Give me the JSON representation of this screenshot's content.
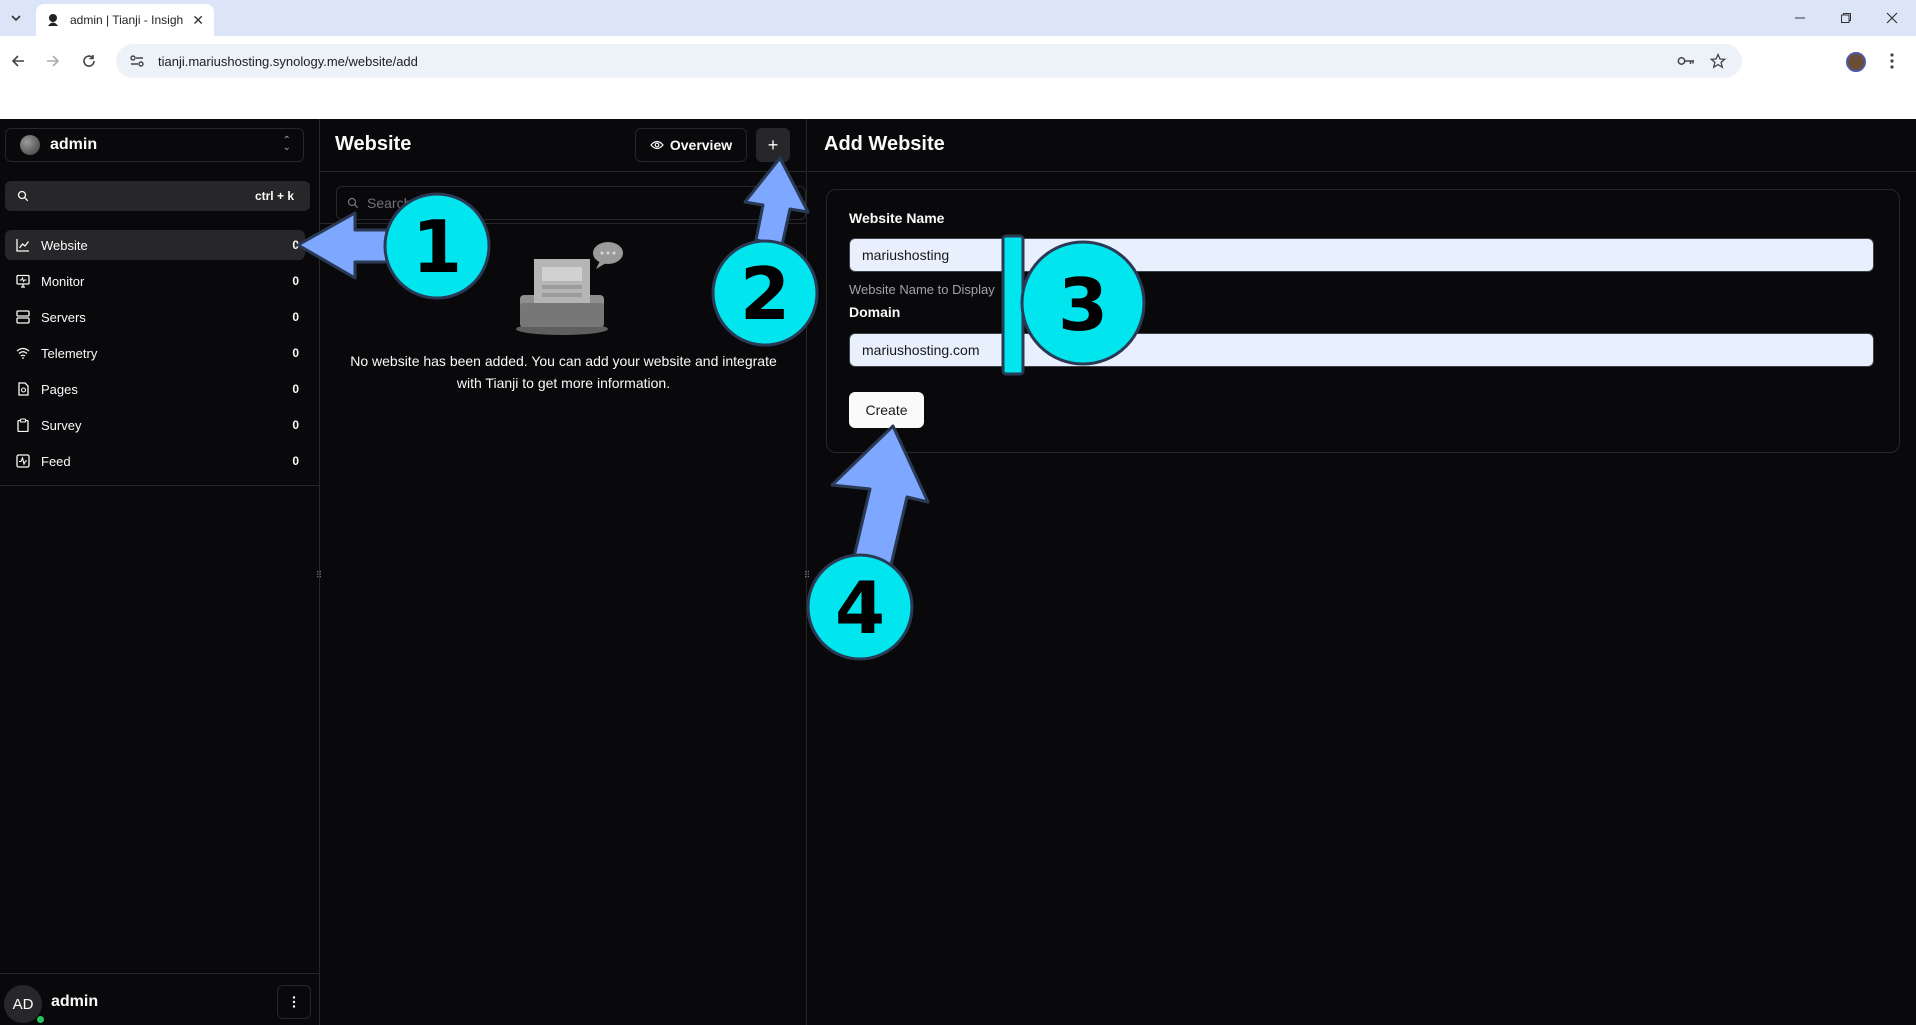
{
  "browser": {
    "tab_title": "admin | Tianji - Insigh",
    "url": "tianji.mariushosting.synology.me/website/add"
  },
  "workspace": {
    "name": "admin"
  },
  "search": {
    "shortcut": "ctrl + k"
  },
  "sidebar": {
    "items": [
      {
        "label": "Website",
        "count": "0",
        "icon": "chart-icon"
      },
      {
        "label": "Monitor",
        "count": "0",
        "icon": "monitor-icon"
      },
      {
        "label": "Servers",
        "count": "0",
        "icon": "server-icon"
      },
      {
        "label": "Telemetry",
        "count": "0",
        "icon": "wifi-icon"
      },
      {
        "label": "Pages",
        "count": "0",
        "icon": "pages-icon"
      },
      {
        "label": "Survey",
        "count": "0",
        "icon": "clipboard-icon"
      },
      {
        "label": "Feed",
        "count": "0",
        "icon": "activity-icon"
      }
    ]
  },
  "user": {
    "initials": "AD",
    "name": "admin",
    "status_color": "#22c55e"
  },
  "list_panel": {
    "title": "Website",
    "overview_label": "Overview",
    "add_label": "+",
    "search_placeholder": "Search",
    "empty_text": "No website has been added. You can add your website and integrate with Tianji to get more information."
  },
  "form": {
    "title": "Add Website",
    "name_label": "Website Name",
    "name_value": "mariushosting",
    "name_help": "Website Name to Display",
    "domain_label": "Domain",
    "domain_value": "mariushosting.com",
    "submit_label": "Create"
  },
  "annotations": {
    "steps": [
      "1",
      "2",
      "3",
      "4"
    ],
    "circle_color": "#00e5ee",
    "arrow_color": "#7ea7ff"
  }
}
